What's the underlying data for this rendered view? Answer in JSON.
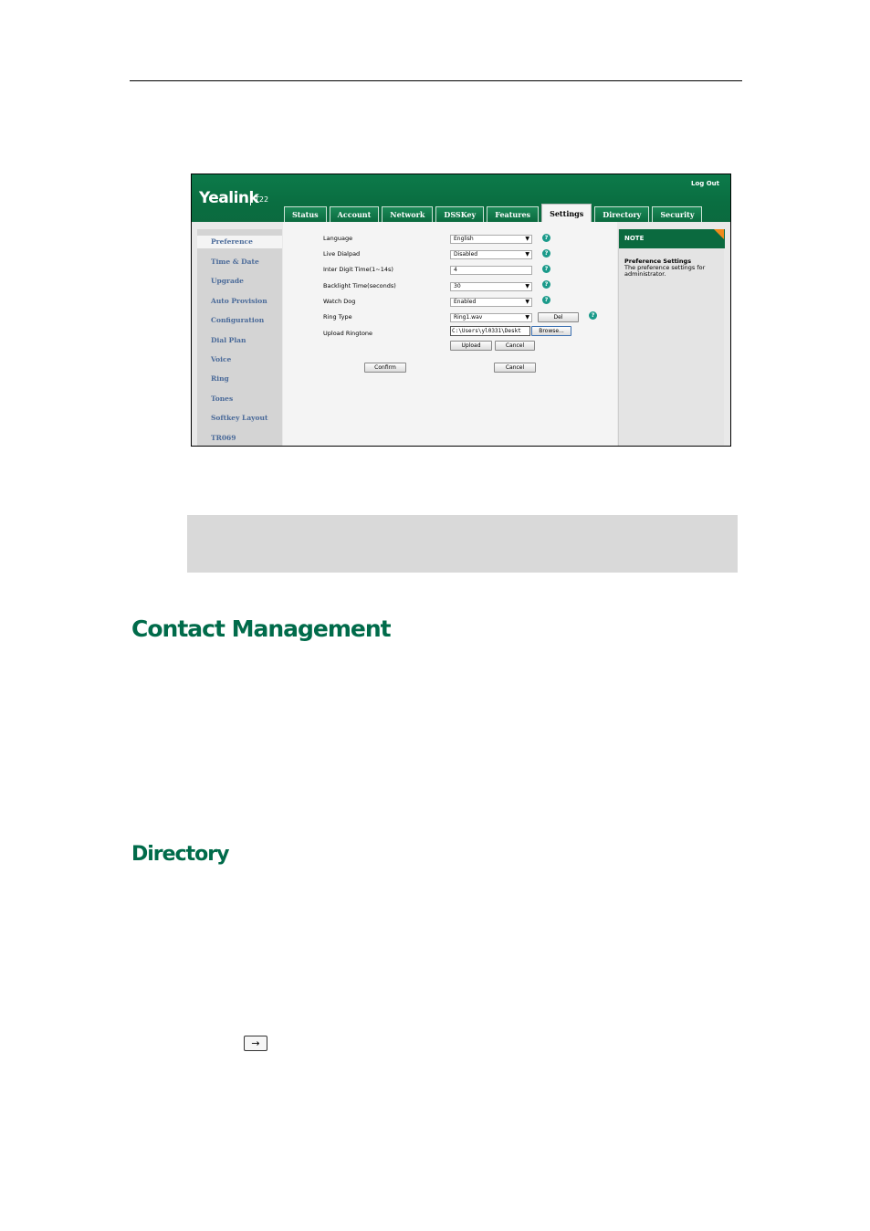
{
  "app": {
    "logo": "Yealink",
    "model": "T22",
    "logout": "Log Out",
    "tabs": [
      "Status",
      "Account",
      "Network",
      "DSSKey",
      "Features",
      "Settings",
      "Directory",
      "Security"
    ],
    "active_tab": "Settings",
    "sidebar": [
      "Preference",
      "Time & Date",
      "Upgrade",
      "Auto Provision",
      "Configuration",
      "Dial Plan",
      "Voice",
      "Ring",
      "Tones",
      "Softkey Layout",
      "TR069"
    ],
    "active_sidebar": "Preference",
    "fields": {
      "language": {
        "label": "Language",
        "value": "English"
      },
      "live_dialpad": {
        "label": "Live Dialpad",
        "value": "Disabled"
      },
      "inter_digit": {
        "label": "Inter Digit Time(1~14s)",
        "value": "4"
      },
      "backlight": {
        "label": "Backlight Time(seconds)",
        "value": "30"
      },
      "watch_dog": {
        "label": "Watch Dog",
        "value": "Enabled"
      },
      "ring_type": {
        "label": "Ring Type",
        "value": "Ring1.wav"
      },
      "upload_ringtone": {
        "label": "Upload Ringtone",
        "value": "C:\\Users\\yl0331\\Deskt"
      }
    },
    "buttons": {
      "del": "Del",
      "browse": "Browse...",
      "upload": "Upload",
      "cancel_small": "Cancel",
      "confirm": "Confirm",
      "cancel": "Cancel"
    },
    "note": {
      "header": "NOTE",
      "title": "Preference Settings",
      "text": "The preference settings for administrator."
    }
  },
  "doc": {
    "heading1": "Contact Management",
    "heading2": "Directory",
    "key_symbol": "→"
  }
}
